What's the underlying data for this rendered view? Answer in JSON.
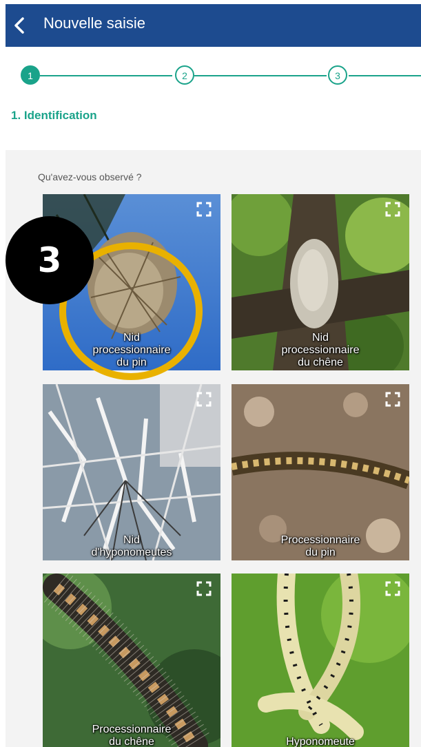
{
  "header": {
    "title": "Nouvelle saisie",
    "back_icon": "chevron-left-icon"
  },
  "stepper": {
    "steps": [
      {
        "number": "1",
        "state": "active"
      },
      {
        "number": "2",
        "state": "inactive"
      },
      {
        "number": "3",
        "state": "inactive"
      }
    ],
    "current_title": "1. Identification",
    "accent_color": "#1aa38a"
  },
  "question": "Qu'avez-vous observé ?",
  "cards": [
    {
      "label": "Nid\nprocessionnaire\ndu pin",
      "icon": "expand-icon"
    },
    {
      "label": "Nid\nprocessionnaire\ndu chêne",
      "icon": "expand-icon"
    },
    {
      "label": "Nid\nd'hyponomeutes",
      "icon": "expand-icon"
    },
    {
      "label": "Processionnaire\ndu pin",
      "icon": "expand-icon"
    },
    {
      "label": "Processionnaire\ndu chêne",
      "icon": "expand-icon"
    },
    {
      "label": "Hyponomeute",
      "icon": "expand-icon"
    }
  ],
  "annotation": {
    "badge_number": "3",
    "ring_color": "#e9b100"
  },
  "colors": {
    "header": "#1d4b8f",
    "accent": "#1aa38a"
  }
}
